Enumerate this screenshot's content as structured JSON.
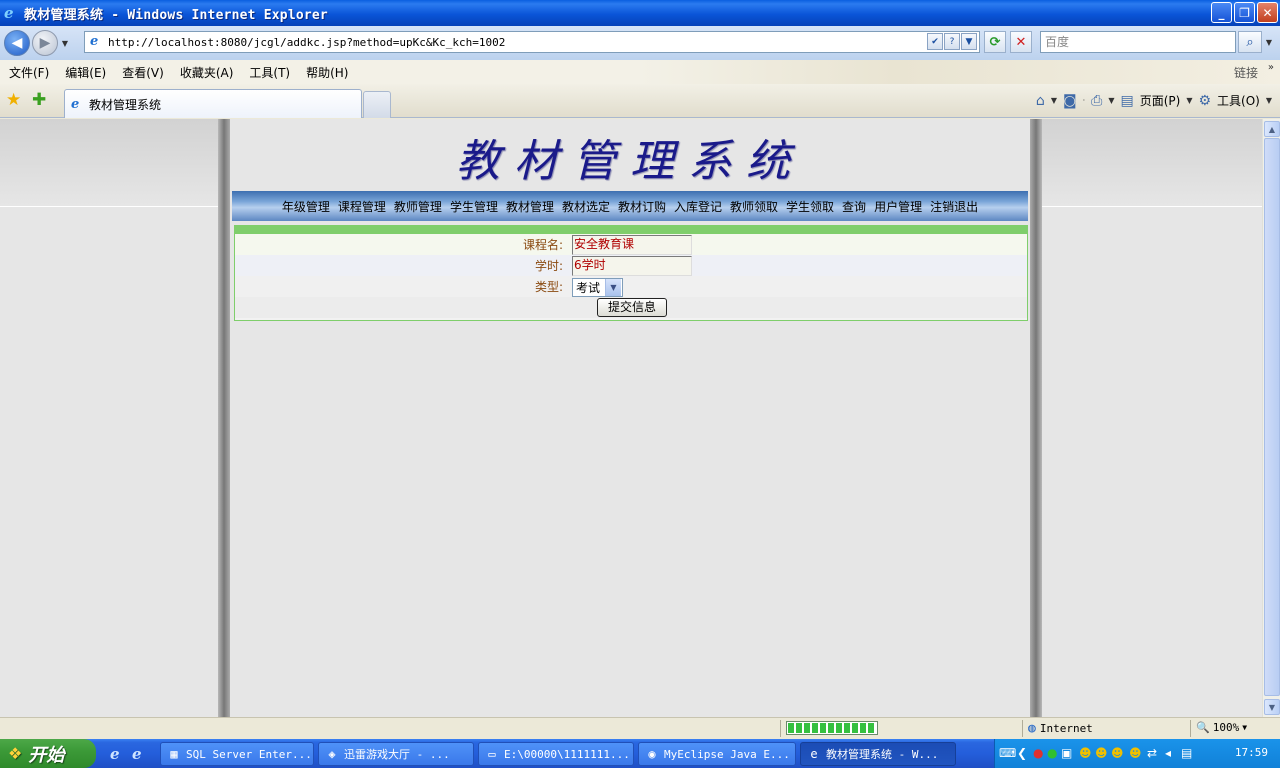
{
  "window": {
    "title": "教材管理系统 - Windows Internet Explorer",
    "icon": "ie-icon",
    "minimize_glyph": "_",
    "restore_glyph": "❐",
    "close_glyph": "✕"
  },
  "address_bar": {
    "url": "http://localhost:8080/jcgl/addkc.jsp?method=upKc&Kc_kch=1002",
    "search_placeholder": "百度"
  },
  "menu": {
    "items": [
      "文件(F)",
      "编辑(E)",
      "查看(V)",
      "收藏夹(A)",
      "工具(T)",
      "帮助(H)"
    ],
    "links_label": "链接"
  },
  "tabs": {
    "active_label": "教材管理系统"
  },
  "command_bar": {
    "page_label": "页面(P)",
    "tools_label": "工具(O)"
  },
  "page": {
    "banner_title": "教材管理系统",
    "nav_items": [
      "年级管理",
      "课程管理",
      "教师管理",
      "学生管理",
      "教材管理",
      "教材选定",
      "教材订购",
      "入库登记",
      "教师领取",
      "学生领取",
      "查询",
      "用户管理",
      "注销退出"
    ],
    "form": {
      "course_name_label": "课程名:",
      "course_name_value": "安全教育课",
      "hours_label": "学时:",
      "hours_value": "6学时",
      "type_label": "类型:",
      "type_value": "考试",
      "submit_label": "提交信息"
    }
  },
  "status_bar": {
    "zone": "Internet",
    "zoom": "100%",
    "progress": 1.0
  },
  "taskbar": {
    "start_label": "开始",
    "buttons": [
      "SQL Server Enter...",
      "迅雷游戏大厅 - ...",
      "E:\\00000\\1111111...",
      "MyEclipse Java E...",
      "教材管理系统 - W..."
    ],
    "clock": "17:59"
  },
  "colors": {
    "title_bar": "#0a55d8",
    "nav_strip": "#5c87c2",
    "form_green": "#7fce6b",
    "banner_text": "#1a1a8a",
    "start_green": "#3c9a38"
  }
}
